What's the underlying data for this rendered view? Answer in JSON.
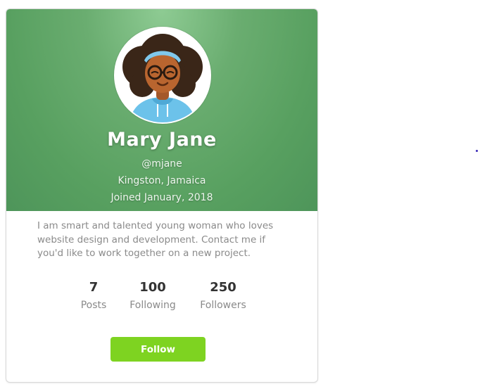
{
  "profile": {
    "name": "Mary Jane",
    "handle": "@mjane",
    "location": "Kingston, Jamaica",
    "joined": "Joined January, 2018",
    "bio": "I am smart and talented young woman who loves website design and development. Contact me if you'd like to work together on a new project."
  },
  "stats": [
    {
      "value": "7",
      "label": "Posts"
    },
    {
      "value": "100",
      "label": "Following"
    },
    {
      "value": "250",
      "label": "Followers"
    }
  ],
  "actions": {
    "follow_label": "Follow"
  },
  "colors": {
    "header_green": "#58a060",
    "follow_button": "#7ed321"
  },
  "icons": {
    "avatar": "woman-with-glasses-avatar"
  }
}
